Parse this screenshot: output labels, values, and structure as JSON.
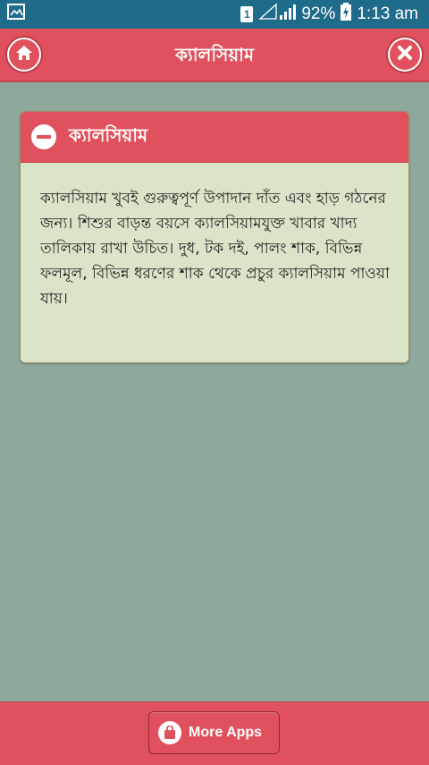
{
  "status_bar": {
    "sim": "1",
    "battery": "92%",
    "time": "1:13 am",
    "icons": [
      "gallery-icon",
      "signal-icon",
      "battery-icon"
    ]
  },
  "toolbar": {
    "title": "ক্যালসিয়াম",
    "home_icon": "home-icon",
    "close_icon": "close-icon"
  },
  "card": {
    "title": "ক্যালসিয়াম",
    "body": "ক্যালসিয়াম খুবই গুরুত্বপূর্ণ উপাদান দাঁত এবং হাড় গঠনের জন্য। শিশুর বাড়ন্ত বয়সে ক্যালসিয়ামযুক্ত খাবার খাদ্য তালিকায় রাখা উচিত। দুধ, টক দই, পালং শাক, বিভিন্ন ফলমূল, বিভিন্ন ধরণের শাক থেকে প্রচুর ক্যালসিয়াম পাওয়া যায়।"
  },
  "bottom": {
    "more_apps_label": "More Apps",
    "more_apps_icon": "shopping-bag-icon"
  },
  "colors": {
    "accent": "#e0515d",
    "background": "#8fa89c",
    "card_bg": "#d9e4c8",
    "status_bar": "#1f6b8a"
  }
}
